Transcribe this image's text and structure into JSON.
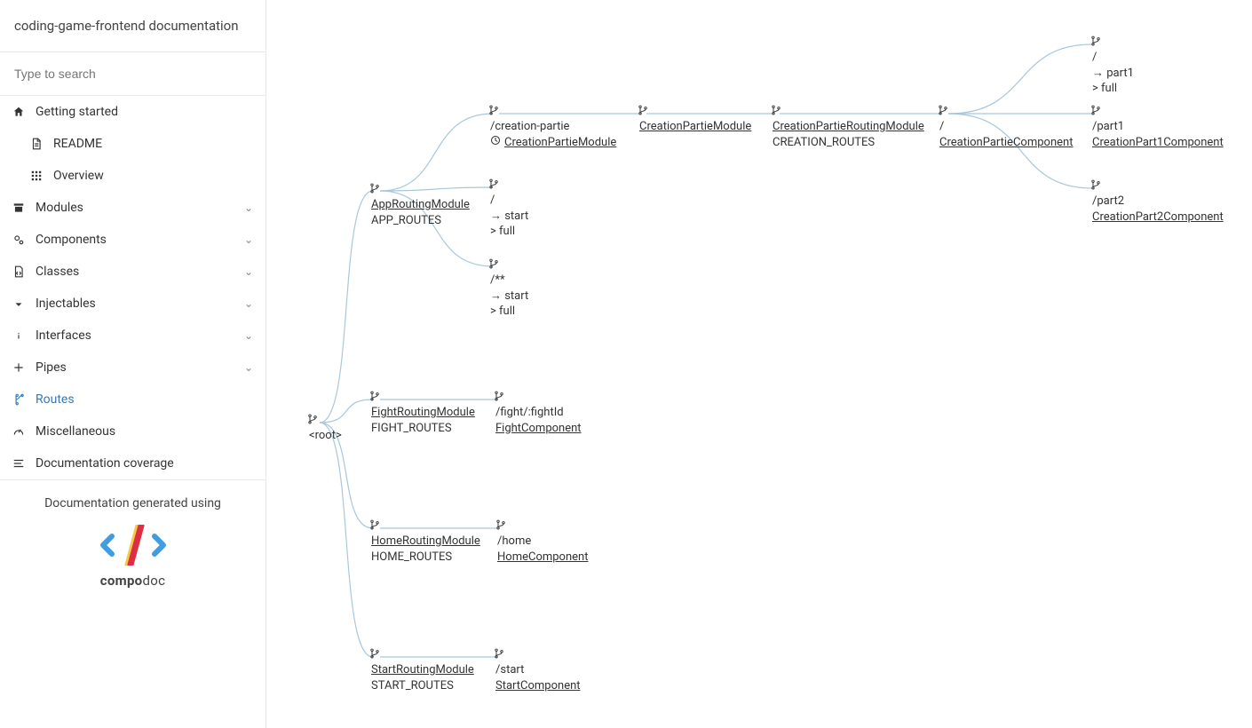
{
  "header": {
    "title": "coding-game-frontend documentation"
  },
  "search": {
    "placeholder": "Type to search"
  },
  "nav": {
    "getting_started": "Getting started",
    "readme": "README",
    "overview": "Overview",
    "modules": "Modules",
    "components": "Components",
    "classes": "Classes",
    "injectables": "Injectables",
    "interfaces": "Interfaces",
    "pipes": "Pipes",
    "routes": "Routes",
    "misc": "Miscellaneous",
    "coverage": "Documentation coverage"
  },
  "credit": {
    "text": "Documentation generated using",
    "logo_word_bold": "compo",
    "logo_word_light": "doc"
  },
  "tree": {
    "root": {
      "label": "<root>"
    },
    "appRouting": {
      "title": "AppRoutingModule",
      "subtitle": "APP_ROUTES"
    },
    "creationPartie": {
      "path": "/creation-partie",
      "module": "CreationPartieModule"
    },
    "redirectStart1": {
      "path": "/",
      "redirect": "→ start",
      "match": "> full"
    },
    "redirectStart2": {
      "path": "/**",
      "redirect": "→ start",
      "match": "> full"
    },
    "creationPartieModule": {
      "title": "CreationPartieModule"
    },
    "creationPartieRoutingModule": {
      "title": "CreationPartieRoutingModule",
      "subtitle": "CREATION_ROUTES"
    },
    "creationPartieComponent": {
      "path": "/",
      "component": "CreationPartieComponent"
    },
    "redirectPart1": {
      "path": "/",
      "redirect": "→ part1",
      "match": "> full"
    },
    "part1": {
      "path": "/part1",
      "component": "CreationPart1Component"
    },
    "part2": {
      "path": "/part2",
      "component": "CreationPart2Component"
    },
    "fightRouting": {
      "title": "FightRoutingModule",
      "subtitle": "FIGHT_ROUTES"
    },
    "fight": {
      "path": "/fight/:fightId",
      "component": "FightComponent"
    },
    "homeRouting": {
      "title": "HomeRoutingModule",
      "subtitle": "HOME_ROUTES"
    },
    "home": {
      "path": "/home",
      "component": "HomeComponent"
    },
    "startRouting": {
      "title": "StartRoutingModule",
      "subtitle": "START_ROUTES"
    },
    "start": {
      "path": "/start",
      "component": "StartComponent"
    }
  }
}
